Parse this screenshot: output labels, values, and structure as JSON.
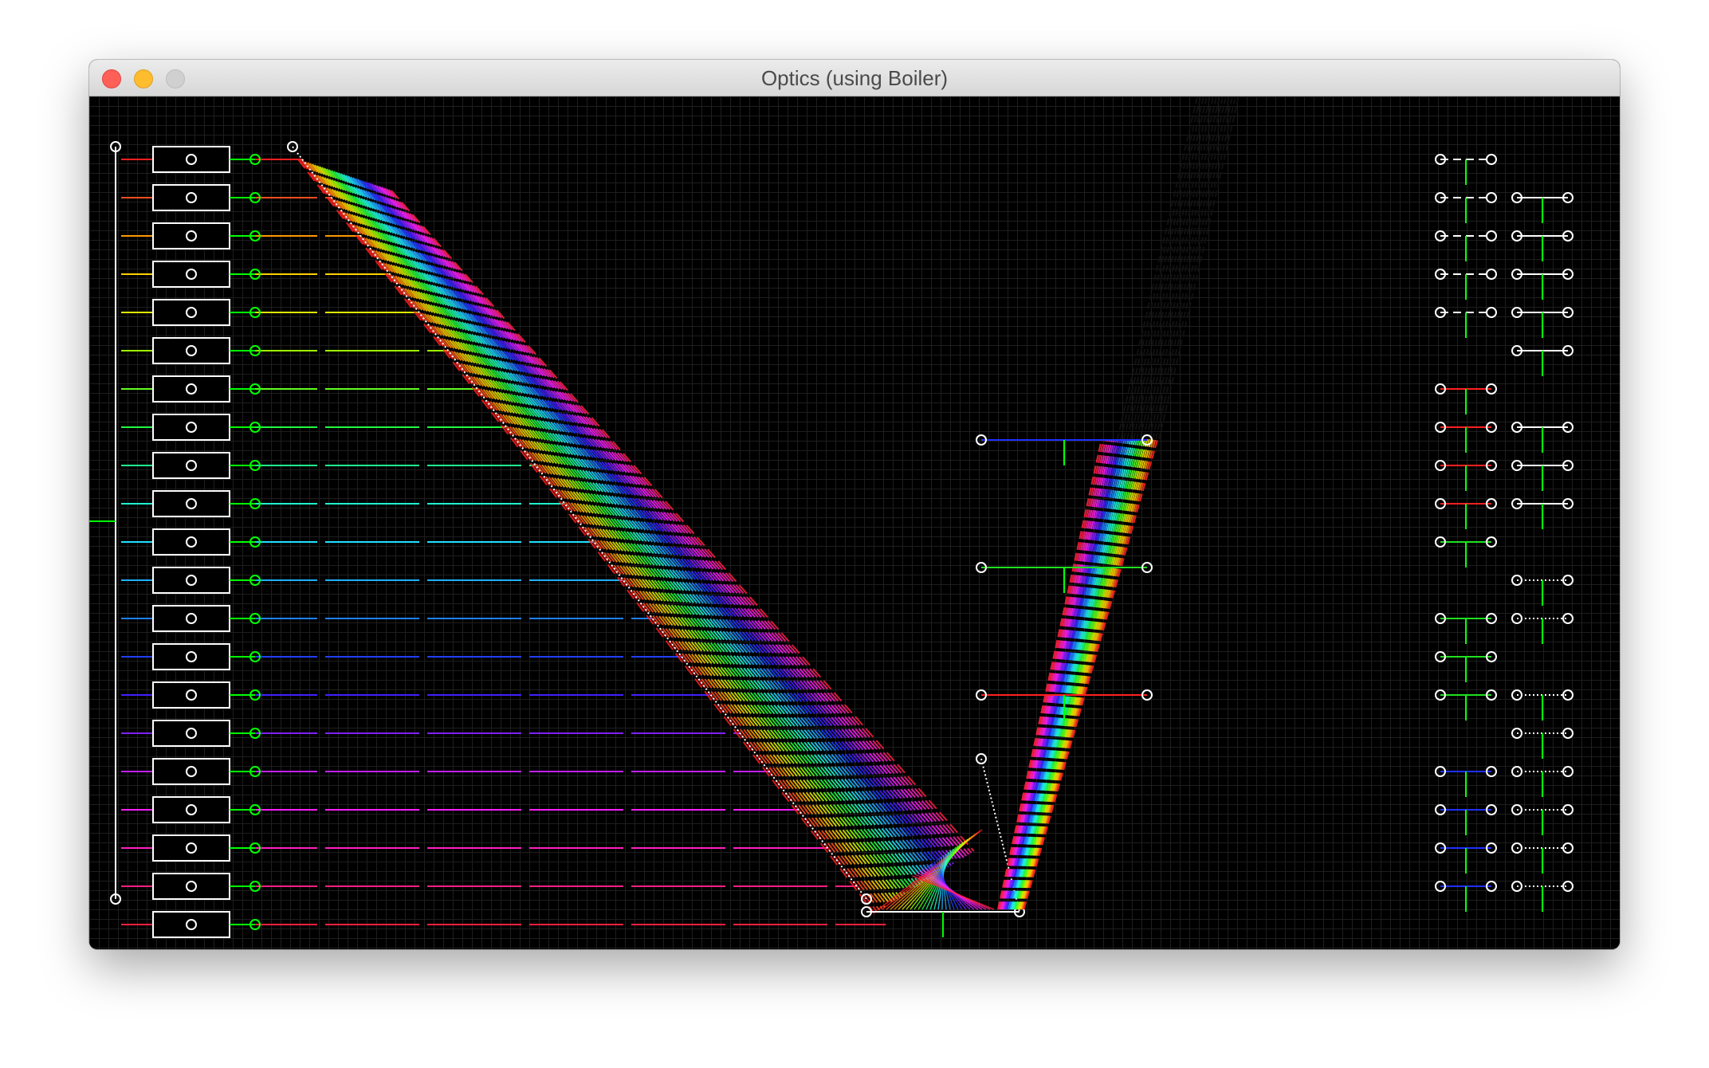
{
  "window": {
    "title": "Optics (using Boiler)"
  },
  "colors": {
    "window_border": "#b2b2b2",
    "canvas_bg": "#000000",
    "grid": "#1e1e1e",
    "handle": "#ffffff",
    "source_handle": "#00ff00",
    "close_button": "#fe5f57",
    "minimize_button": "#febc2e",
    "zoom_button_disabled": "#d0d0d0"
  },
  "icons": {
    "close": "close-icon",
    "minimize": "minimize-icon",
    "zoom": "zoom-icon",
    "handle": "handle-circle-icon",
    "light_source": "light-source-box-icon"
  },
  "light_sources": {
    "colors": [
      "#ff2020",
      "#ff5020",
      "#ff9800",
      "#ffd000",
      "#e0f000",
      "#a0ff00",
      "#60ff20",
      "#20ff40",
      "#20ff90",
      "#20ffd0",
      "#20e0ff",
      "#20b0ff",
      "#2080ff",
      "#2040ff",
      "#4020ff",
      "#8020ff",
      "#c020ff",
      "#ff20ff",
      "#ff20c0",
      "#ff2080",
      "#ff2040"
    ]
  },
  "filters": [
    {
      "name": "filter-blue",
      "color": "#2030ff"
    },
    {
      "name": "filter-green",
      "color": "#20e020"
    },
    {
      "name": "filter-red",
      "color": "#ff2020"
    }
  ],
  "legend_panel": {
    "left_column": [
      "white-dashed",
      "white-dashed",
      "white-dashed",
      "white-dashed",
      "white-dashed",
      "none",
      "red",
      "red",
      "red",
      "red",
      "green",
      "none",
      "green",
      "green",
      "green",
      "none",
      "blue",
      "blue",
      "blue",
      "blue"
    ],
    "right_column": [
      "none",
      "white-solid",
      "white-solid",
      "white-solid",
      "white-solid",
      "white-solid",
      "none",
      "white-solid",
      "white-solid",
      "white-solid",
      "none",
      "white-dotted",
      "white-dotted",
      "none",
      "white-dotted",
      "white-dotted",
      "white-dotted",
      "white-dotted",
      "white-dotted",
      "white-dotted"
    ]
  }
}
